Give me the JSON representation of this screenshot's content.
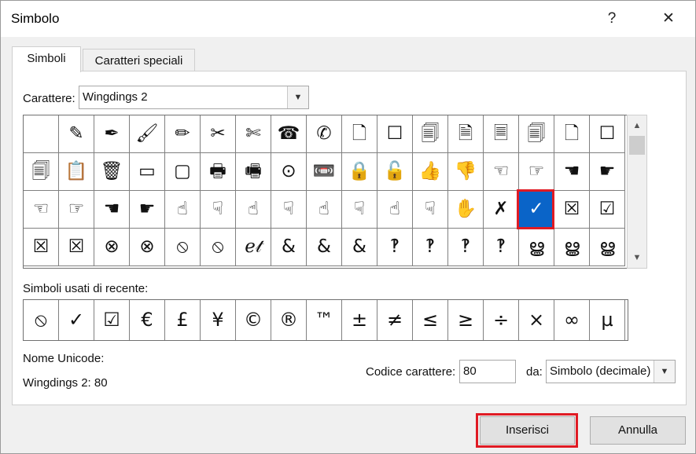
{
  "window": {
    "title": "Simbolo",
    "help_label": "?",
    "close_label": "✕"
  },
  "tabs": [
    {
      "label": "Simboli",
      "active": true
    },
    {
      "label": "Caratteri speciali",
      "active": false
    }
  ],
  "font_label": "Carattere:",
  "font_value": "Wingdings 2",
  "symbol_grid": [
    [
      "",
      "✎",
      "✒",
      "🖌",
      "✏",
      "✂",
      "✄",
      "☎",
      "✆",
      "🗋",
      "☐",
      "🗐",
      "🗎",
      "🗏",
      "🗐",
      "🗋",
      "☐"
    ],
    [
      "🗐",
      "📋",
      "🗑",
      "▭",
      "▢",
      "🖶",
      "🖷",
      "⊙",
      "📼",
      "🔒",
      "🔓",
      "👍",
      "👎",
      "☜",
      "☞",
      "☚",
      "☛"
    ],
    [
      "☜",
      "☞",
      "☚",
      "☛",
      "☝",
      "☟",
      "☝",
      "☟",
      "☝",
      "☟",
      "☝",
      "☟",
      "✋",
      "✗",
      "✓",
      "☒",
      "☑"
    ],
    [
      "☒",
      "☒",
      "⊗",
      "⊗",
      "⦸",
      "⦸",
      "ℯ𝓉",
      "&",
      "&",
      "&",
      "‽",
      "‽",
      "‽",
      "‽",
      "ൠ",
      "ൠ",
      "ൠ"
    ]
  ],
  "selected_symbol": {
    "row": 2,
    "col": 14
  },
  "recent_label": "Simboli usati di recente:",
  "recent_symbols": [
    "⦸",
    "✓",
    "☑",
    "€",
    "£",
    "¥",
    "©",
    "®",
    "™",
    "±",
    "≠",
    "≤",
    "≥",
    "÷",
    "×",
    "∞",
    "µ"
  ],
  "unicode_name_label": "Nome Unicode:",
  "unicode_name_value": "Wingdings 2: 80",
  "char_code_label": "Codice carattere:",
  "char_code_value": "80",
  "from_label": "da:",
  "from_value": "Simbolo (decimale)",
  "buttons": {
    "insert": "Inserisci",
    "cancel": "Annulla"
  },
  "scroll_up_icon": "chevron-up-icon",
  "scroll_down_icon": "chevron-down-icon",
  "accent_color": "#0a64c8",
  "highlight_color": "#e01b24"
}
